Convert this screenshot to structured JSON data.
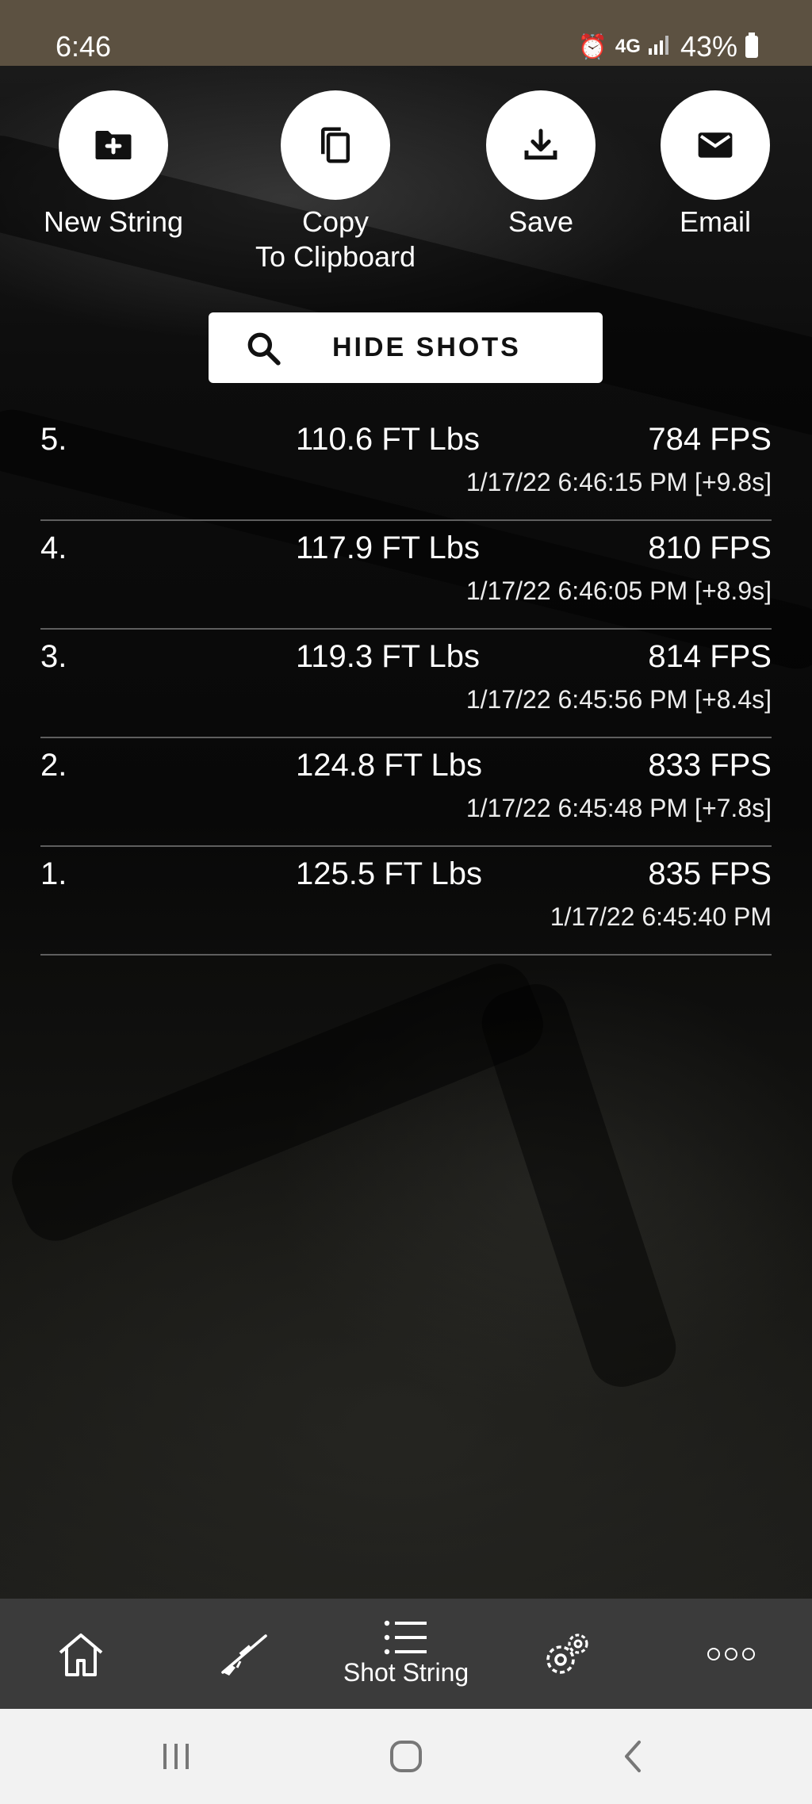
{
  "status_bar": {
    "time": "6:46",
    "network": "4G",
    "battery": "43%"
  },
  "actions": [
    {
      "label": "New String",
      "icon": "folder-add-icon"
    },
    {
      "label": "Copy\nTo Clipboard",
      "icon": "copy-icon"
    },
    {
      "label": "Save",
      "icon": "download-icon"
    },
    {
      "label": "Email",
      "icon": "mail-icon"
    }
  ],
  "hide_shots": {
    "label": "HIDE SHOTS",
    "icon": "search-icon"
  },
  "shots": [
    {
      "number": "5.",
      "energy": "110.6 FT Lbs",
      "fps": "784 FPS",
      "timestamp": "1/17/22 6:46:15 PM [+9.8s]"
    },
    {
      "number": "4.",
      "energy": "117.9 FT Lbs",
      "fps": "810 FPS",
      "timestamp": "1/17/22 6:46:05 PM [+8.9s]"
    },
    {
      "number": "3.",
      "energy": "119.3 FT Lbs",
      "fps": "814 FPS",
      "timestamp": "1/17/22 6:45:56 PM [+8.4s]"
    },
    {
      "number": "2.",
      "energy": "124.8 FT Lbs",
      "fps": "833 FPS",
      "timestamp": "1/17/22 6:45:48 PM [+7.8s]"
    },
    {
      "number": "1.",
      "energy": "125.5 FT Lbs",
      "fps": "835 FPS",
      "timestamp": "1/17/22 6:45:40 PM"
    }
  ],
  "bottom_nav": {
    "items": [
      {
        "icon": "home-icon",
        "label": ""
      },
      {
        "icon": "rifle-icon",
        "label": ""
      },
      {
        "icon": "list-icon",
        "label": "Shot String"
      },
      {
        "icon": "gear-icon",
        "label": ""
      },
      {
        "icon": "more-icon",
        "label": ""
      }
    ],
    "active_index": 2
  },
  "system_nav": {
    "buttons": [
      "recents-icon",
      "home-circle-icon",
      "back-icon"
    ]
  }
}
